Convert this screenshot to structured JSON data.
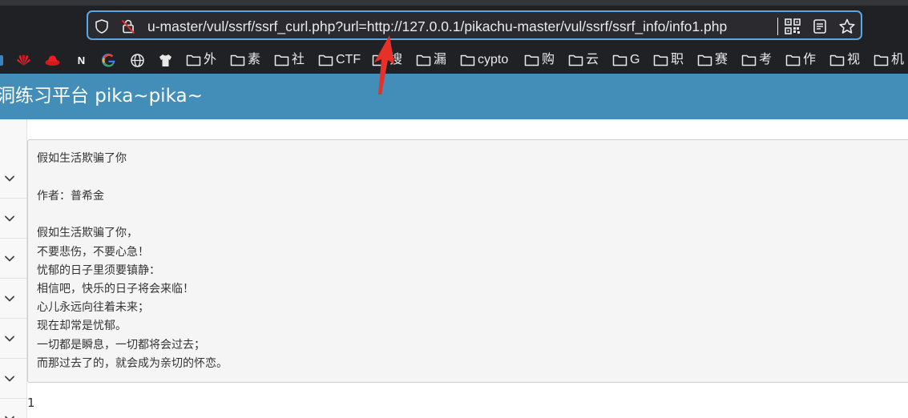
{
  "browser": {
    "url": "u-master/vul/ssrf/ssrf_curl.php?url=http://127.0.0.1/pikachu-master/vul/ssrf/ssrf_info/info1.php",
    "icons": [
      "shield-icon",
      "lock-slash-icon",
      "qr-code-icon",
      "reader-icon",
      "star-icon"
    ],
    "accent": "#5aa7e6"
  },
  "bookmarks": [
    {
      "icon": "huawei-icon",
      "label": ""
    },
    {
      "icon": "redhat-icon",
      "label": ""
    },
    {
      "icon": "n-icon",
      "label": "N"
    },
    {
      "icon": "google-icon",
      "label": ""
    },
    {
      "icon": "globe-icon",
      "label": ""
    },
    {
      "icon": "shirt-icon",
      "label": ""
    },
    {
      "icon": "folder-icon",
      "label": "外"
    },
    {
      "icon": "folder-icon",
      "label": "素"
    },
    {
      "icon": "folder-icon",
      "label": "社"
    },
    {
      "icon": "folder-icon",
      "label": "CTF"
    },
    {
      "icon": "folder-icon",
      "label": "搜"
    },
    {
      "icon": "folder-icon",
      "label": "漏"
    },
    {
      "icon": "folder-icon",
      "label": "cypto"
    },
    {
      "icon": "folder-icon",
      "label": "购"
    },
    {
      "icon": "folder-icon",
      "label": "云"
    },
    {
      "icon": "folder-icon",
      "label": "G"
    },
    {
      "icon": "folder-icon",
      "label": "职"
    },
    {
      "icon": "folder-icon",
      "label": "赛"
    },
    {
      "icon": "folder-icon",
      "label": "考"
    },
    {
      "icon": "folder-icon",
      "label": "作"
    },
    {
      "icon": "folder-icon",
      "label": "视"
    },
    {
      "icon": "folder-icon",
      "label": "机"
    }
  ],
  "header": {
    "title": "洞练习平台 pika~pika~",
    "color": "#438eb9"
  },
  "sidebar": {
    "items": [
      {
        "icon": "chevron-down-icon"
      },
      {
        "icon": "chevron-down-icon"
      },
      {
        "icon": "chevron-down-icon"
      },
      {
        "icon": "chevron-down-icon"
      },
      {
        "icon": "chevron-down-icon"
      },
      {
        "icon": "chevron-down-icon"
      },
      {
        "icon": "chevron-down-icon"
      }
    ]
  },
  "content": {
    "title": "假如生活欺骗了你",
    "author": "作者：普希金",
    "lines": [
      "假如生活欺骗了你，",
      "不要悲伤，不要心急！",
      "忧郁的日子里须要镇静：",
      "相信吧，快乐的日子将会来临！",
      "心儿永远向往着未来；",
      "现在却常是忧郁。",
      "一切都是瞬息，一切都将会过去；",
      "而那过去了的，就会成为亲切的怀恋。"
    ],
    "footer_number": "1"
  },
  "annotation": {
    "icon": "red-arrow-icon",
    "color": "#e8302a"
  }
}
